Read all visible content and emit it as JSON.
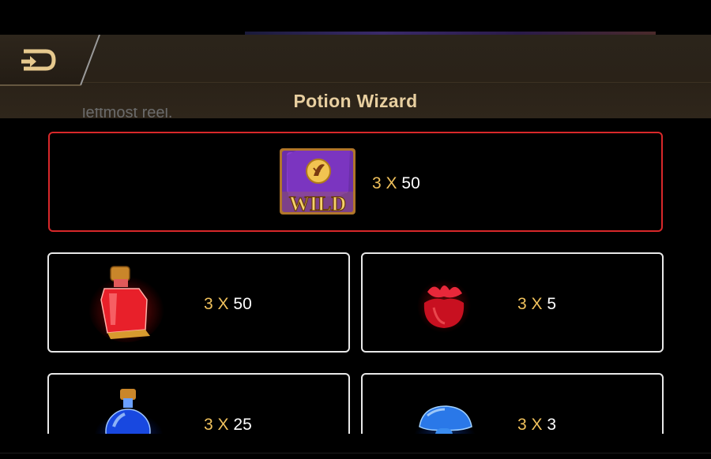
{
  "header": {
    "title": "Potion Wizard",
    "back_icon": "back-arrow-icon"
  },
  "rules_text_fragment": "leftmost reel.",
  "featured": {
    "symbol": "wild-book-icon",
    "symbol_label": "WILD",
    "count": "3",
    "times": "X",
    "pay": "50"
  },
  "cards": [
    {
      "symbol": "red-potion-bottle-icon",
      "count": "3",
      "times": "X",
      "pay": "50"
    },
    {
      "symbol": "red-flower-bud-icon",
      "count": "3",
      "times": "X",
      "pay": "5"
    },
    {
      "symbol": "blue-potion-flask-icon",
      "count": "3",
      "times": "X",
      "pay": "25"
    },
    {
      "symbol": "blue-mushroom-icon",
      "count": "3",
      "times": "X",
      "pay": "3"
    }
  ],
  "colors": {
    "header_bg": "#2b241b",
    "title": "#e8cfa0",
    "featured_border": "#d8282a",
    "card_border": "#e8e8e8",
    "multiplier_gold": "#f0c15c"
  }
}
